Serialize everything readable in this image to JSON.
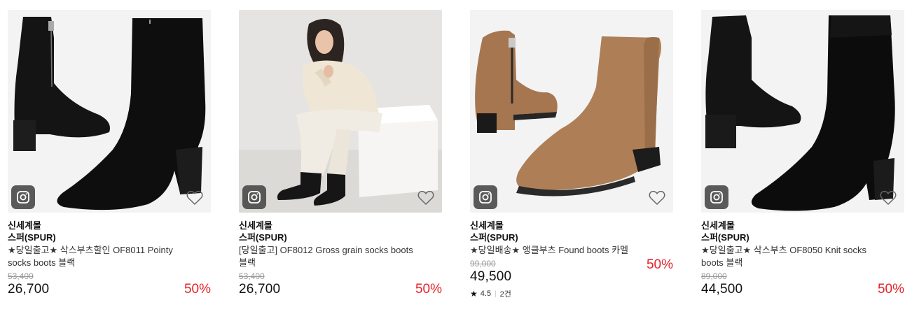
{
  "products": [
    {
      "mall": "신세계몰",
      "brand": "스퍼(SPUR)",
      "name": "★당일출고★ 삭스부츠할인 OF8011 Pointy socks boots 블랙",
      "original_price": "53,400",
      "price": "26,700",
      "discount": "50%"
    },
    {
      "mall": "신세계몰",
      "brand": "스퍼(SPUR)",
      "name": "[당일출고] OF8012 Gross grain socks boots 블랙",
      "original_price": "53,400",
      "price": "26,700",
      "discount": "50%"
    },
    {
      "mall": "신세계몰",
      "brand": "스퍼(SPUR)",
      "name": "★당일배송★ 앵클부츠 Found boots 카멜",
      "original_price": "99,000",
      "price": "49,500",
      "discount": "50%",
      "rating": "4.5",
      "reviews": "2건"
    },
    {
      "mall": "신세계몰",
      "brand": "스퍼(SPUR)",
      "name": "★당일출고★ 삭스부츠 OF8050 Knit socks boots 블랙",
      "original_price": "89,000",
      "price": "44,500",
      "discount": "50%"
    }
  ],
  "icons": {
    "share": "instagram-share-icon",
    "wish": "heart-outline-icon",
    "rating": "star-icon"
  },
  "colors": {
    "discount": "#e5232a",
    "image_bg": "#f2f2f2",
    "camel": "#a87a52",
    "black_suede": "#111111"
  }
}
